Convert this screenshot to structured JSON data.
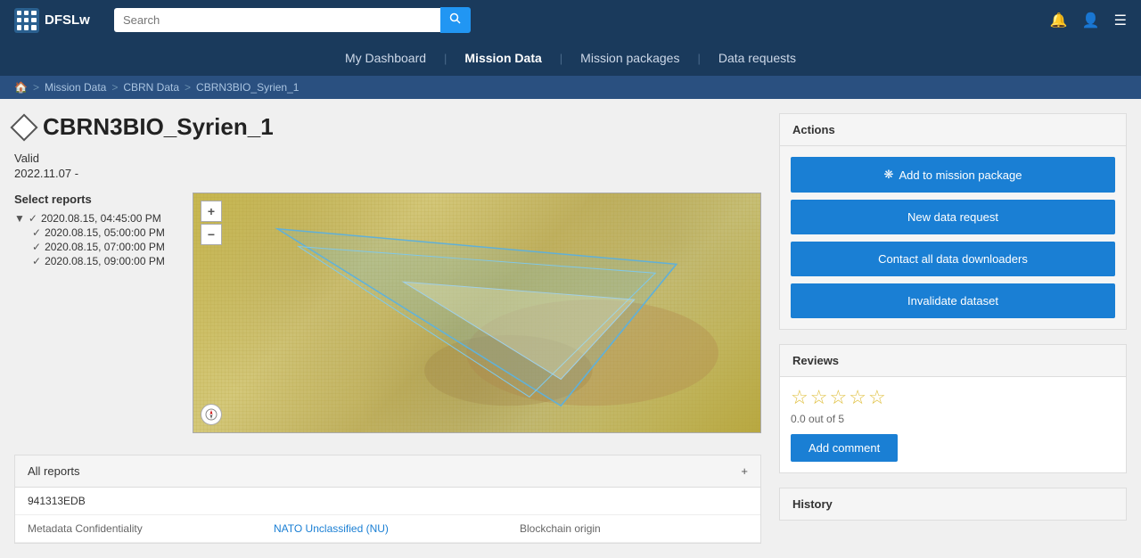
{
  "app": {
    "logo_text": "DFSLw",
    "logo_icon": "⊞"
  },
  "search": {
    "placeholder": "Search",
    "value": ""
  },
  "nav": {
    "items": [
      {
        "label": "My Dashboard",
        "active": false
      },
      {
        "label": "Mission Data",
        "active": true
      },
      {
        "label": "Mission packages",
        "active": false
      },
      {
        "label": "Data requests",
        "active": false
      }
    ]
  },
  "breadcrumb": {
    "home": "🏠",
    "items": [
      {
        "label": "Mission Data"
      },
      {
        "label": "CBRN Data"
      },
      {
        "label": "CBRN3BIO_Syrien_1"
      }
    ]
  },
  "page": {
    "title": "CBRN3BIO_Syrien_1",
    "validity_label": "Valid",
    "validity_date": "2022.11.07 -"
  },
  "reports": {
    "label": "Select reports",
    "items": [
      {
        "indent": false,
        "arrow": true,
        "check": true,
        "label": "2020.08.15, 04:45:00 PM"
      },
      {
        "indent": true,
        "arrow": false,
        "check": true,
        "label": "2020.08.15, 05:00:00 PM"
      },
      {
        "indent": true,
        "arrow": false,
        "check": true,
        "label": "2020.08.15, 07:00:00 PM"
      },
      {
        "indent": true,
        "arrow": false,
        "check": true,
        "label": "2020.08.15, 09:00:00 PM"
      }
    ]
  },
  "map": {
    "zoom_in": "+",
    "zoom_out": "−"
  },
  "all_reports": {
    "header": "All reports",
    "id": "941313EDB",
    "metadata_confidentiality_label": "Metadata Confidentiality",
    "metadata_confidentiality_value": "NATO Unclassified (NU)",
    "blockchain_origin_label": "Blockchain origin"
  },
  "actions": {
    "title": "Actions",
    "buttons": [
      {
        "label": "Add to mission package",
        "icon": "❋"
      },
      {
        "label": "New data request",
        "icon": ""
      },
      {
        "label": "Contact all data downloaders",
        "icon": ""
      },
      {
        "label": "Invalidate dataset",
        "icon": ""
      }
    ]
  },
  "reviews": {
    "title": "Reviews",
    "rating": 0,
    "max_rating": 5,
    "rating_text": "0.0 out of 5",
    "stars": [
      "☆",
      "☆",
      "☆",
      "☆",
      "☆"
    ],
    "add_comment_label": "Add comment"
  },
  "history": {
    "title": "History"
  },
  "icons": {
    "bell": "🔔",
    "user": "👤",
    "menu": "☰",
    "search": "🔍"
  }
}
